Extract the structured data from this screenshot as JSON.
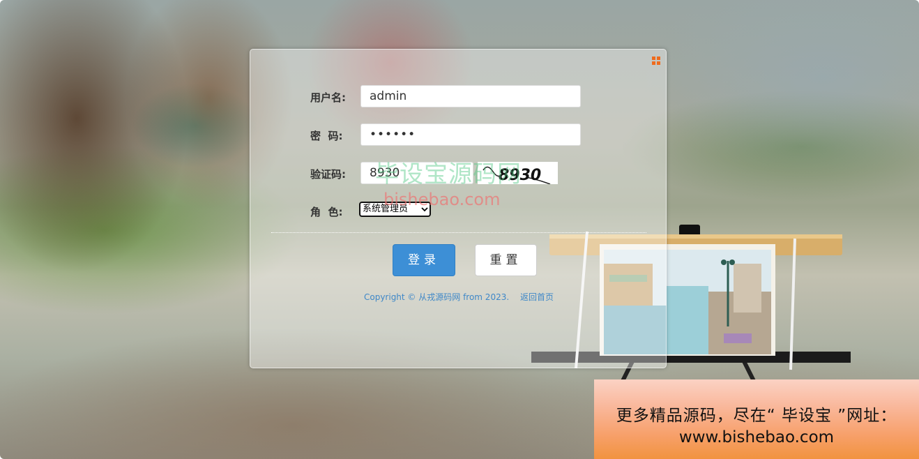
{
  "form": {
    "username_label": "用户名:",
    "username_value": "admin",
    "password_label": "密  码:",
    "password_value": "••••••",
    "captcha_label": "验证码:",
    "captcha_value": "8930",
    "captcha_image_text": "8930",
    "role_label": "角  色:",
    "role_selected": "系统管理员"
  },
  "buttons": {
    "login": "登录",
    "reset": "重置"
  },
  "footer": {
    "copyright": "Copyright © 从戎源码网 from 2023.",
    "home_link": "返回首页"
  },
  "watermark": {
    "line1": "毕设宝源码网",
    "line2": "bishebao.com"
  },
  "promo": {
    "line1": "更多精品源码，尽在“ 毕设宝 ”网址：",
    "line2": "www.bishebao.com"
  },
  "colors": {
    "login_button": "#3d8fd6",
    "accent_orange": "#ef6b1d",
    "link_blue": "#3f88c8"
  },
  "icons": {
    "corner": "grid-icon",
    "select_arrow": "chevron-down-icon"
  }
}
